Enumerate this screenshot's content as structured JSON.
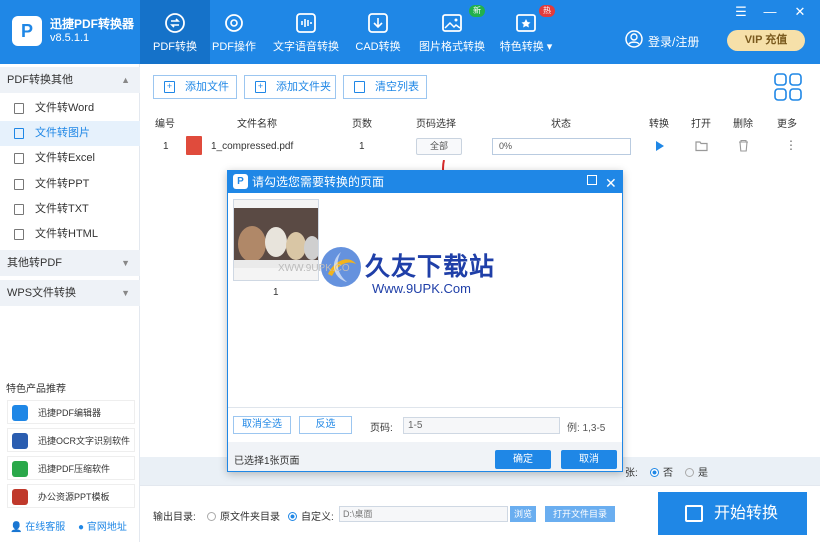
{
  "app": {
    "name": "迅捷PDF转换器",
    "version": "v8.5.1.1",
    "logo_glyph": "P"
  },
  "nav": [
    {
      "label": "PDF转换",
      "icon": "pdf-convert-icon",
      "active": true
    },
    {
      "label": "PDF操作",
      "icon": "pdf-operate-icon"
    },
    {
      "label": "文字语音转换",
      "icon": "voice-wave-icon"
    },
    {
      "label": "CAD转换",
      "icon": "cad-icon"
    },
    {
      "label": "图片格式转换",
      "icon": "image-icon",
      "badge": "新"
    },
    {
      "label": "特色转换 ▾",
      "icon": "special-convert-icon",
      "badge": "热"
    }
  ],
  "window": {
    "menu": "☰",
    "min": "—",
    "close": "✕"
  },
  "account": {
    "login": "登录/注册",
    "vip": "VIP 充值"
  },
  "sidebar": {
    "groups": [
      {
        "label": "PDF转换其他"
      },
      {
        "label": "其他转PDF"
      },
      {
        "label": "WPS文件转换"
      }
    ],
    "items": [
      {
        "label": "文件转Word"
      },
      {
        "label": "文件转图片",
        "active": true
      },
      {
        "label": "文件转Excel"
      },
      {
        "label": "文件转PPT"
      },
      {
        "label": "文件转TXT"
      },
      {
        "label": "文件转HTML"
      }
    ],
    "promo_title": "特色产品推荐",
    "promos": [
      {
        "label": "迅捷PDF编辑器",
        "color": "#1f87e6"
      },
      {
        "label": "迅捷OCR文字识别软件",
        "color": "#2a5db0"
      },
      {
        "label": "迅捷PDF压缩软件",
        "color": "#2aa84a"
      },
      {
        "label": "办公资源PPT模板",
        "color": "#c0392b"
      }
    ],
    "support": "在线客服",
    "website": "官网地址"
  },
  "toolbar": {
    "add_file": "添加文件",
    "add_folder": "添加文件夹",
    "clear": "清空列表"
  },
  "table": {
    "headers": [
      "编号",
      "文件名称",
      "页数",
      "页码选择",
      "状态",
      "转换",
      "打开",
      "删除",
      "更多"
    ],
    "rows": [
      {
        "index": "1",
        "name": "1_compressed.pdf",
        "pages": "1",
        "page_select": "全部",
        "status": "0%"
      }
    ]
  },
  "bottom": {
    "merge_suffix": "张:",
    "no": "否",
    "yes": "是",
    "output_label": "输出目录:",
    "opt_original": "原文件夹目录",
    "opt_custom": "自定义:",
    "path": "D:\\桌面",
    "browse": "浏览",
    "open_dir": "打开文件目录",
    "start": "开始转换"
  },
  "dialog": {
    "title": "请勾选您需要转换的页面",
    "thumb_label": "1",
    "deselect_all": "取消全选",
    "invert": "反选",
    "page_label": "页码:",
    "page_value": "1-5",
    "example": "例: 1,3-5",
    "selected_info": "已选择1张页面",
    "ok": "确定",
    "cancel": "取消"
  },
  "watermark": {
    "brand": "久友下载站",
    "url": "Www.9UPK.Com",
    "small": "XWW.9UPK.CO"
  },
  "colors": {
    "accent": "#1f87e6",
    "vip_bg": "#f6e0a9",
    "pdf_red": "#e04b3c"
  }
}
